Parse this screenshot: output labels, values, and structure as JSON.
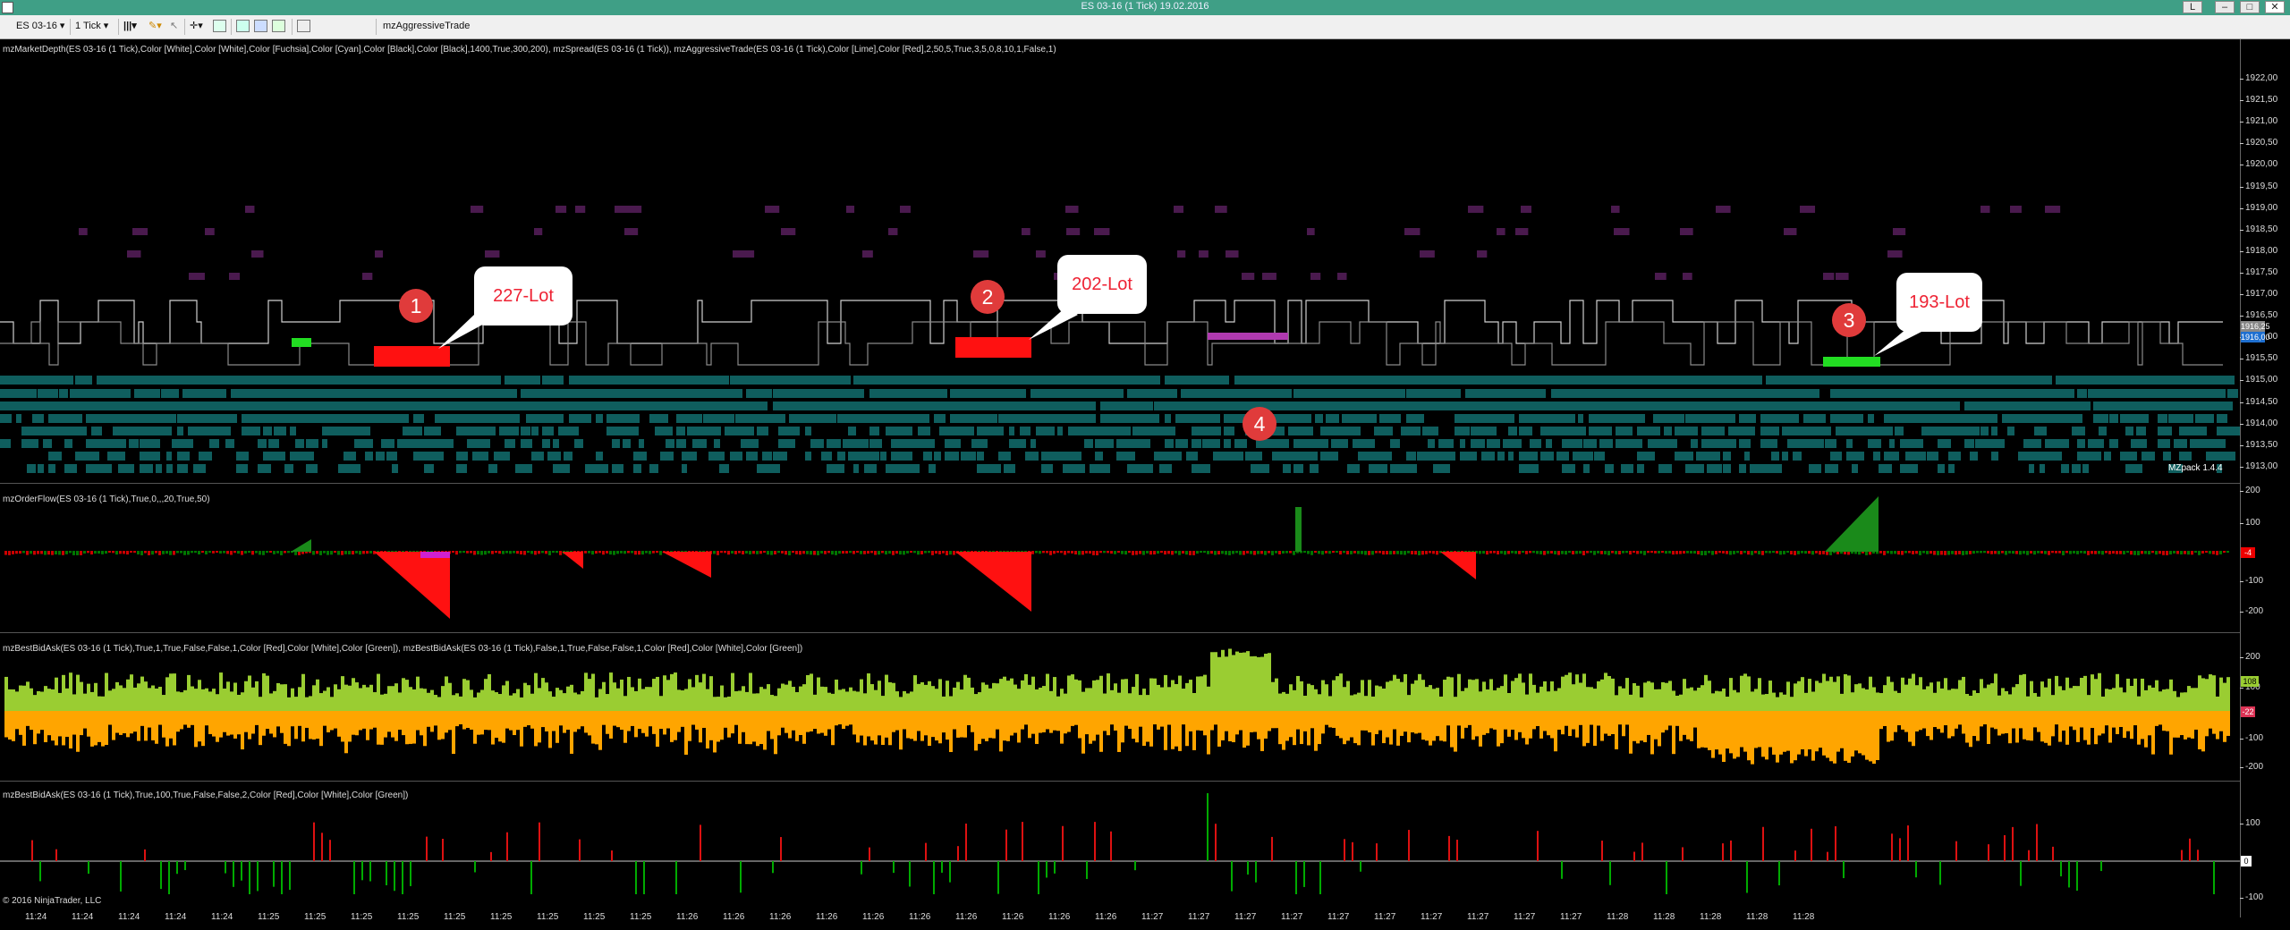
{
  "window": {
    "title": "ES 03-16 (1 Tick)  19.02.2016",
    "buttons": {
      "help": "L",
      "minimize": "–",
      "maximize": "□",
      "close": "✕"
    }
  },
  "toolbar": {
    "instrument": "ES 03-16",
    "interval": "1 Tick",
    "strategy_label": "mzAggressiveTrade",
    "icons": [
      "bar-style-icon",
      "draw-icon",
      "pointer-icon",
      "crosshair-icon",
      "zoom-icon",
      "properties-icon",
      "data-box-icon",
      "strategies-icon",
      "share-icon"
    ]
  },
  "panels": {
    "price": {
      "label": "mzMarketDepth(ES 03-16 (1 Tick),Color [White],Color [White],Color [Fuchsia],Color [Cyan],Color [Black],Color [Black],1400,True,300,200), mzSpread(ES 03-16 (1 Tick)), mzAggressiveTrade(ES 03-16 (1 Tick),Color [Lime],Color [Red],2,50,5,True,3,5,0,8,10,1,False,1)",
      "y_ticks": [
        "1922,00",
        "1921,50",
        "1921,00",
        "1920,50",
        "1920,00",
        "1919,50",
        "1919,00",
        "1918,50",
        "1918,00",
        "1917,50",
        "1917,00",
        "1916,50",
        "1916,00",
        "1915,50",
        "1915,00",
        "1914,50",
        "1914,00",
        "1913,50",
        "1913,00"
      ],
      "last_ask": "1916,25",
      "last_bid": "1916,00",
      "watermark": "MZpack 1.4.4",
      "callouts": [
        {
          "num": "1",
          "text": "227-Lot"
        },
        {
          "num": "2",
          "text": "202-Lot"
        },
        {
          "num": "3",
          "text": "193-Lot"
        },
        {
          "num": "4",
          "text": ""
        }
      ]
    },
    "orderflow": {
      "label": "mzOrderFlow(ES 03-16 (1 Tick),True,0,,,20,True,50)",
      "y_ticks": [
        "200",
        "100",
        "-100",
        "-200"
      ],
      "value": "-4"
    },
    "bestbidask1": {
      "label": "mzBestBidAsk(ES 03-16 (1 Tick),True,1,True,False,False,1,Color [Red],Color [White],Color [Green]), mzBestBidAsk(ES 03-16 (1 Tick),False,1,True,False,False,1,Color [Red],Color [White],Color [Green])",
      "y_ticks": [
        "200",
        "100",
        "-100",
        "-200"
      ],
      "value_top": "108",
      "value_bottom": "-22"
    },
    "bestbidask2": {
      "label": "mzBestBidAsk(ES 03-16 (1 Tick),True,100,True,False,False,2,Color [Red],Color [White],Color [Green])",
      "y_ticks": [
        "100",
        "-100"
      ],
      "value": "0"
    }
  },
  "copyright": "© 2016 NinjaTrader, LLC",
  "x_ticks": [
    "11:24",
    "11:24",
    "11:24",
    "11:24",
    "11:24",
    "11:25",
    "11:25",
    "11:25",
    "11:25",
    "11:25",
    "11:25",
    "11:25",
    "11:25",
    "11:25",
    "11:26",
    "11:26",
    "11:26",
    "11:26",
    "11:26",
    "11:26",
    "11:26",
    "11:26",
    "11:26",
    "11:26",
    "11:27",
    "11:27",
    "11:27",
    "11:27",
    "11:27",
    "11:27",
    "11:27",
    "11:27",
    "11:27",
    "11:27",
    "11:28",
    "11:28",
    "11:28",
    "11:28",
    "11:28"
  ],
  "colors": {
    "lime": "#22dd22",
    "red": "#ff1111",
    "teal": "#0f5e5e",
    "ask": "#9acd32",
    "bid": "#ffa500"
  }
}
